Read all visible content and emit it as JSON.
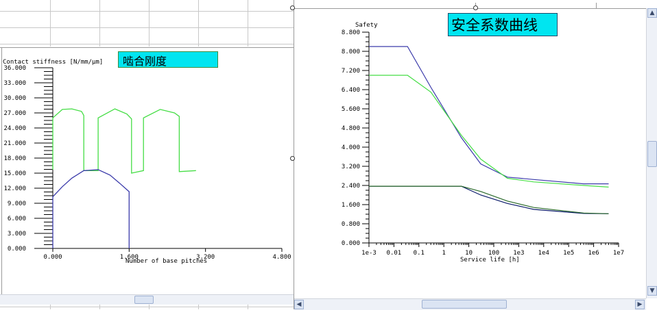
{
  "left_chart": {
    "caption": "啮合刚度",
    "ylabel": "Contact stiffness [N/mm/μm]",
    "xlabel": "Number of base pitches",
    "y_ticks": [
      "36.000",
      "33.000",
      "30.000",
      "27.000",
      "24.000",
      "21.000",
      "18.000",
      "15.000",
      "12.000",
      "9.000",
      "6.000",
      "3.000",
      "0.000"
    ],
    "x_ticks": [
      "0.000",
      "1.600",
      "3.200",
      "4.800"
    ]
  },
  "right_chart": {
    "caption": "安全系数曲线",
    "ylabel": "Safety",
    "xlabel": "Service life [h]",
    "y_ticks": [
      "8.800",
      "8.000",
      "7.200",
      "6.400",
      "5.600",
      "4.800",
      "4.000",
      "3.200",
      "2.400",
      "1.600",
      "0.800",
      "0.000"
    ],
    "x_ticks": [
      "1e-3",
      "0.01",
      "0.1",
      "1",
      "10",
      "100",
      "1e3",
      "1e4",
      "1e5",
      "1e6",
      "1e7"
    ]
  },
  "colors": {
    "green": "#44dd44",
    "blue": "#3a3aaa",
    "navy": "#0a1a6a",
    "darkgreen": "#2a6a2a",
    "caption_bg": "#00e5f0"
  },
  "chart_data": [
    {
      "type": "line",
      "xlabel": "Number of base pitches",
      "ylabel": "Contact stiffness [N/mm/μm]",
      "xlim": [
        0,
        4.8
      ],
      "ylim": [
        0,
        36
      ],
      "series": [
        {
          "color": "#44dd44",
          "x": [
            0,
            0,
            0.2,
            0.4,
            0.6,
            0.65,
            0.65,
            0.95,
            0.95,
            1.3,
            1.55,
            1.65,
            1.65,
            1.9,
            1.9,
            2.25,
            2.55,
            2.65,
            2.65,
            3.0
          ],
          "y": [
            15.7,
            26.0,
            27.7,
            27.8,
            27.3,
            26.5,
            15.5,
            15.5,
            26.0,
            27.8,
            26.8,
            25.8,
            15.0,
            15.5,
            26.0,
            27.7,
            27.0,
            26.3,
            15.3,
            15.5
          ]
        },
        {
          "color": "#3a3aaa",
          "x": [
            0,
            0,
            0.2,
            0.4,
            0.65,
            0.95,
            1.2,
            1.4,
            1.6,
            1.6
          ],
          "y": [
            0,
            10.3,
            12.3,
            14.0,
            15.5,
            15.7,
            14.6,
            13.0,
            11.3,
            0
          ]
        }
      ]
    },
    {
      "type": "line",
      "xlabel": "Service life [h]",
      "ylabel": "Safety",
      "x_scale": "log",
      "xlim": [
        0.001,
        10000000
      ],
      "ylim": [
        0,
        8.8
      ],
      "series": [
        {
          "color": "#3a3aaa",
          "x": [
            0.001,
            0.0035,
            0.035,
            0.3,
            5,
            30,
            350,
            4000,
            400000,
            4000000
          ],
          "y": [
            8.2,
            8.2,
            8.2,
            6.5,
            4.4,
            3.3,
            2.75,
            2.65,
            2.47,
            2.47
          ]
        },
        {
          "color": "#44dd44",
          "x": [
            0.001,
            0.0035,
            0.035,
            0.3,
            5,
            30,
            350,
            4000,
            400000,
            4000000
          ],
          "y": [
            7.0,
            7.0,
            7.0,
            6.3,
            4.5,
            3.5,
            2.7,
            2.55,
            2.4,
            2.33
          ]
        },
        {
          "color": "#0a1a6a",
          "x": [
            0.001,
            0.0035,
            1,
            5,
            30,
            350,
            4000,
            400000,
            4000000
          ],
          "y": [
            2.37,
            2.37,
            2.37,
            2.37,
            2.0,
            1.65,
            1.4,
            1.23,
            1.22
          ]
        },
        {
          "color": "#2a6a2a",
          "x": [
            0.001,
            0.0035,
            1,
            5,
            30,
            350,
            4000,
            400000,
            4000000
          ],
          "y": [
            2.37,
            2.37,
            2.37,
            2.37,
            2.15,
            1.75,
            1.48,
            1.25,
            1.22
          ]
        }
      ]
    }
  ]
}
